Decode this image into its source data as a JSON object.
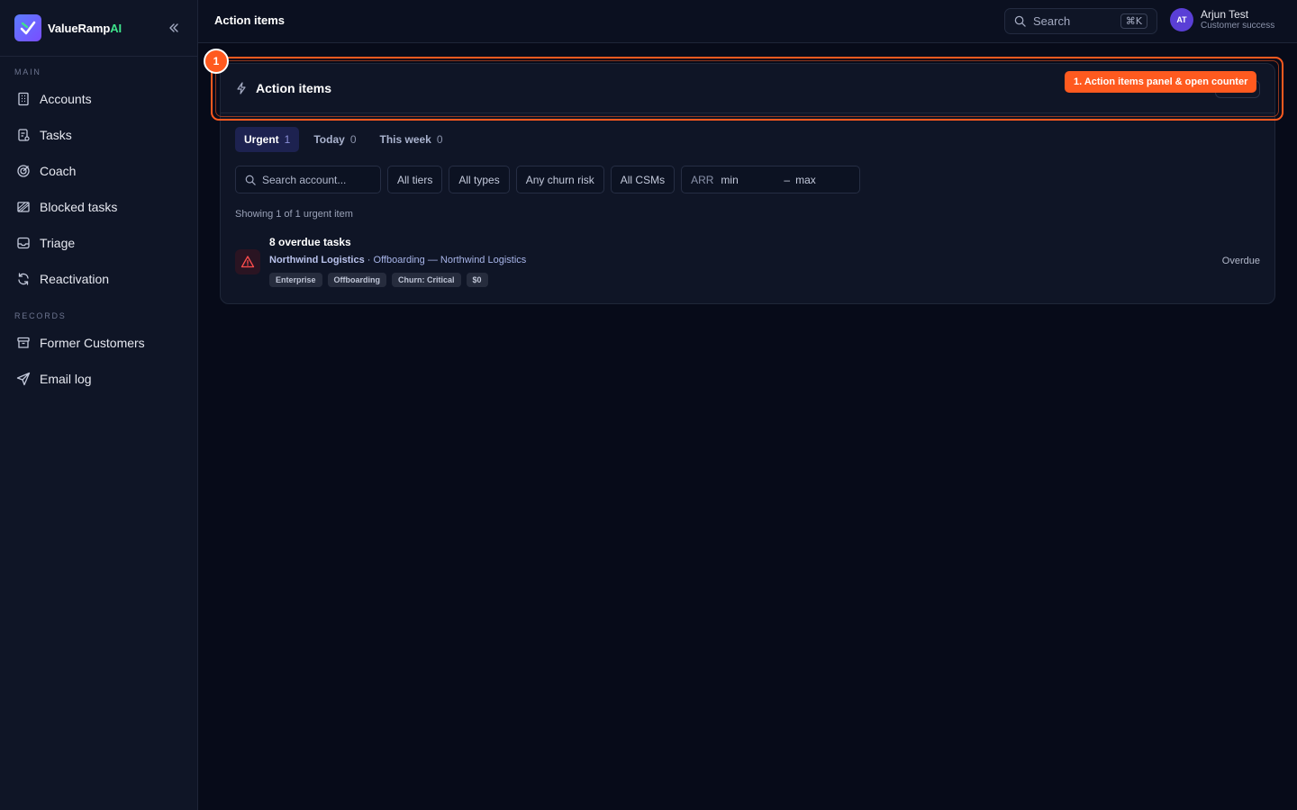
{
  "app": {
    "brand_name": "ValueRamp",
    "brand_suffix": "AI"
  },
  "sidebar": {
    "sections": [
      {
        "label": "MAIN",
        "items": [
          {
            "label": "Accounts",
            "icon": "building-icon"
          },
          {
            "label": "Tasks",
            "icon": "clipboard-icon"
          },
          {
            "label": "Coach",
            "icon": "target-icon"
          },
          {
            "label": "Blocked tasks",
            "icon": "blocked-icon"
          },
          {
            "label": "Triage",
            "icon": "inbox-icon"
          },
          {
            "label": "Reactivation",
            "icon": "refresh-icon"
          }
        ]
      },
      {
        "label": "RECORDS",
        "items": [
          {
            "label": "Former Customers",
            "icon": "archive-icon"
          },
          {
            "label": "Email log",
            "icon": "send-icon"
          }
        ]
      }
    ]
  },
  "topbar": {
    "title": "Action items",
    "search_label": "Search",
    "search_shortcut": "⌘K",
    "user": {
      "initials": "AT",
      "name": "Arjun Test",
      "role": "Customer success"
    }
  },
  "panel": {
    "title": "Action items",
    "tabs": [
      {
        "label": "Urgent",
        "count": "1",
        "active": true
      },
      {
        "label": "Today",
        "count": "0",
        "active": false
      },
      {
        "label": "This week",
        "count": "0",
        "active": false
      }
    ],
    "filters": {
      "search_placeholder": "Search account...",
      "tiers": "All tiers",
      "types": "All types",
      "churn": "Any churn risk",
      "csms": "All CSMs",
      "arr_label": "ARR",
      "arr_min": "min",
      "arr_sep": "–",
      "arr_max": "max"
    },
    "showing": "Showing 1 of 1 urgent item",
    "items": [
      {
        "title": "8 overdue tasks",
        "account": "Northwind Logistics",
        "detail": " · Offboarding — Northwind Logistics",
        "chips": [
          "Enterprise",
          "Offboarding",
          "Churn: Critical",
          "$0"
        ],
        "status": "Overdue"
      }
    ]
  },
  "annotation": {
    "number": "1",
    "label": "1. Action items panel & open counter",
    "color": "#ff5a1f"
  }
}
